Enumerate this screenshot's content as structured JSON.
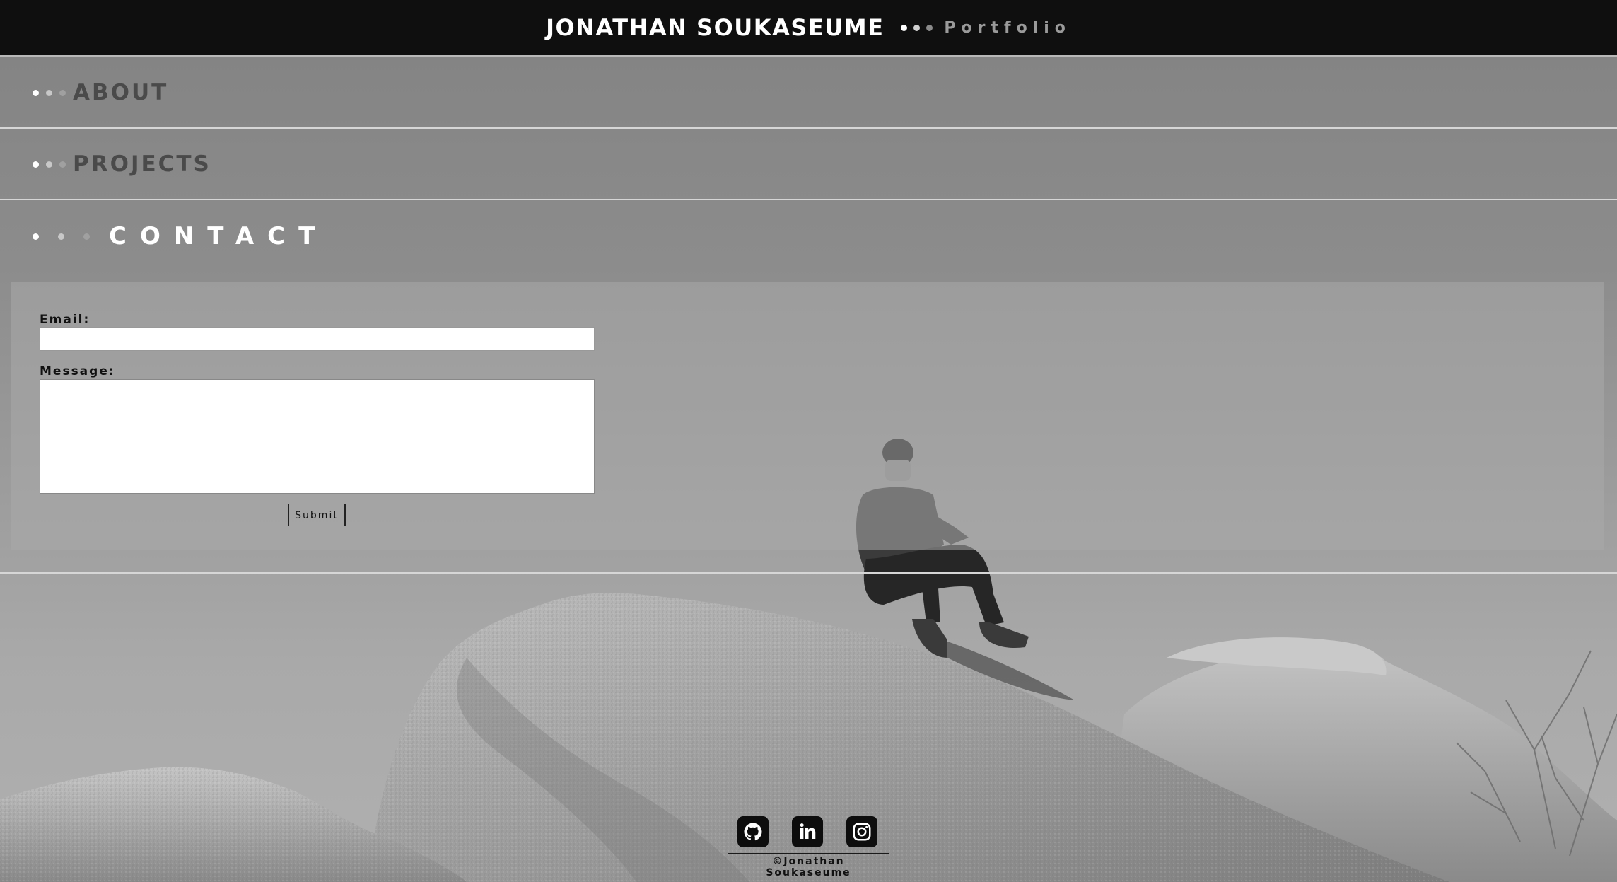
{
  "header": {
    "title": "JONATHAN SOUKASEUME",
    "subtitle": "Portfolio",
    "dot_colors": [
      "#ffffff",
      "#cfcfcf",
      "#8a8a8a"
    ]
  },
  "nav": {
    "about_label": "ABOUT",
    "projects_label": "PROJECTS",
    "contact_label": "CONTACT",
    "dot_colors": [
      "#ffffff",
      "#c8c8c8",
      "#a0a0a0"
    ]
  },
  "contact_form": {
    "email_label": "Email:",
    "email_value": "",
    "message_label": "Message:",
    "message_value": "",
    "submit_label": "Submit"
  },
  "footer": {
    "icons": [
      "github-icon",
      "linkedin-icon",
      "instagram-icon"
    ],
    "copyright": "©Jonathan Soukaseume"
  },
  "colors": {
    "header_bg": "#0f0f0f",
    "accent_text": "#ffffff",
    "nav_text": "#4a4a4a"
  }
}
